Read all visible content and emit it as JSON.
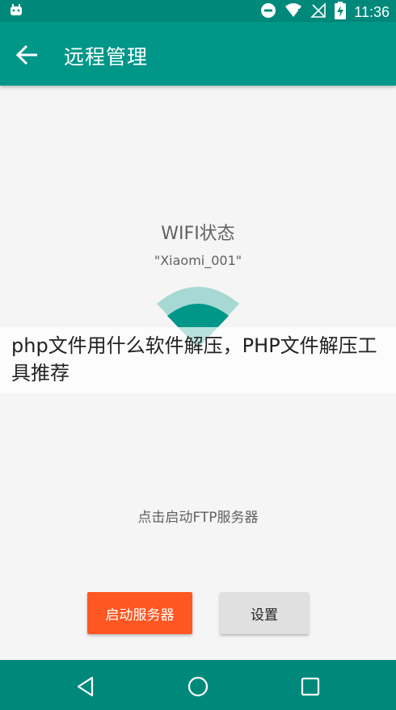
{
  "status_bar": {
    "time": "11:36",
    "left_icon": "android-icon",
    "right_icons": [
      "do-not-disturb-icon",
      "wifi-icon",
      "signal-off-icon",
      "battery-charging-icon"
    ]
  },
  "app_bar": {
    "back_icon": "arrow-left-icon",
    "title": "远程管理"
  },
  "main": {
    "wifi_title": "WIFI状态",
    "wifi_ssid": "\"Xiaomi_001\"",
    "overlay_text": "php文件用什么软件解压，PHP文件解压工具推荐",
    "hint": "点击启动FTP服务器",
    "start_button": "启动服务器",
    "settings_button": "设置"
  },
  "nav_bar": {
    "icons": [
      "back-triangle-icon",
      "home-circle-icon",
      "recents-square-icon"
    ]
  },
  "colors": {
    "primary": "#009688",
    "primary_dark": "#00897b",
    "accent": "#ff5722",
    "wifi_light": "#a7d9d4"
  }
}
